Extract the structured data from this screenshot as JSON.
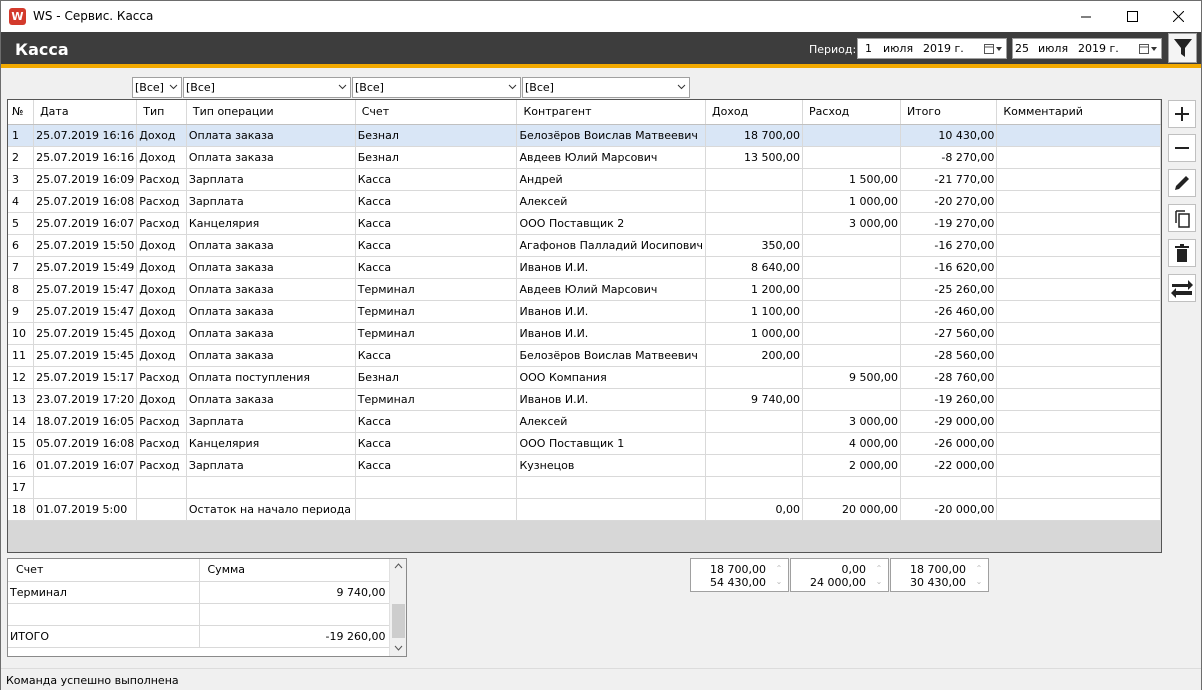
{
  "window": {
    "title": "WS - Сервис. Касса",
    "app_icon_letter": "W"
  },
  "header": {
    "title": "Касса",
    "period_label": "Период:",
    "date_from": {
      "day": "1",
      "month": "июля",
      "year": "2019 г."
    },
    "date_to": {
      "day": "25",
      "month": "июля",
      "year": "2019 г."
    }
  },
  "filters": [
    "[Все]",
    "[Все]",
    "[Все]",
    "[Все]"
  ],
  "grid": {
    "columns": [
      "№",
      "Дата",
      "Тип",
      "Тип операции",
      "Счет",
      "Контрагент",
      "Доход",
      "Расход",
      "Итого",
      "Комментарий"
    ],
    "rows": [
      [
        "1",
        "25.07.2019 16:16",
        "Доход",
        "Оплата заказа",
        "Безнал",
        "Белозёров Воислав Матвеевич",
        "18 700,00",
        "",
        "10 430,00",
        ""
      ],
      [
        "2",
        "25.07.2019 16:16",
        "Доход",
        "Оплата заказа",
        "Безнал",
        "Авдеев Юлий Марсович",
        "13 500,00",
        "",
        "-8 270,00",
        ""
      ],
      [
        "3",
        "25.07.2019 16:09",
        "Расход",
        "Зарплата",
        "Касса",
        "Андрей",
        "",
        "1 500,00",
        "-21 770,00",
        ""
      ],
      [
        "4",
        "25.07.2019 16:08",
        "Расход",
        "Зарплата",
        "Касса",
        "Алексей",
        "",
        "1 000,00",
        "-20 270,00",
        ""
      ],
      [
        "5",
        "25.07.2019 16:07",
        "Расход",
        "Канцелярия",
        "Касса",
        "ООО Поставщик 2",
        "",
        "3 000,00",
        "-19 270,00",
        ""
      ],
      [
        "6",
        "25.07.2019 15:50",
        "Доход",
        "Оплата заказа",
        "Касса",
        "Агафонов Палладий Иосипович",
        "350,00",
        "",
        "-16 270,00",
        ""
      ],
      [
        "7",
        "25.07.2019 15:49",
        "Доход",
        "Оплата заказа",
        "Касса",
        "Иванов И.И.",
        "8 640,00",
        "",
        "-16 620,00",
        ""
      ],
      [
        "8",
        "25.07.2019 15:47",
        "Доход",
        "Оплата заказа",
        "Терминал",
        "Авдеев Юлий Марсович",
        "1 200,00",
        "",
        "-25 260,00",
        ""
      ],
      [
        "9",
        "25.07.2019 15:47",
        "Доход",
        "Оплата заказа",
        "Терминал",
        "Иванов И.И.",
        "1 100,00",
        "",
        "-26 460,00",
        ""
      ],
      [
        "10",
        "25.07.2019 15:45",
        "Доход",
        "Оплата заказа",
        "Терминал",
        "Иванов И.И.",
        "1 000,00",
        "",
        "-27 560,00",
        ""
      ],
      [
        "11",
        "25.07.2019 15:45",
        "Доход",
        "Оплата заказа",
        "Касса",
        "Белозёров Воислав Матвеевич",
        "200,00",
        "",
        "-28 560,00",
        ""
      ],
      [
        "12",
        "25.07.2019 15:17",
        "Расход",
        "Оплата поступления",
        "Безнал",
        "ООО Компания",
        "",
        "9 500,00",
        "-28 760,00",
        ""
      ],
      [
        "13",
        "23.07.2019 17:20",
        "Доход",
        "Оплата заказа",
        "Терминал",
        "Иванов И.И.",
        "9 740,00",
        "",
        "-19 260,00",
        ""
      ],
      [
        "14",
        "18.07.2019 16:05",
        "Расход",
        "Зарплата",
        "Касса",
        "Алексей",
        "",
        "3 000,00",
        "-29 000,00",
        ""
      ],
      [
        "15",
        "05.07.2019 16:08",
        "Расход",
        "Канцелярия",
        "Касса",
        "ООО Поставщик 1",
        "",
        "4 000,00",
        "-26 000,00",
        ""
      ],
      [
        "16",
        "01.07.2019 16:07",
        "Расход",
        "Зарплата",
        "Касса",
        "Кузнецов",
        "",
        "2 000,00",
        "-22 000,00",
        ""
      ],
      [
        "17",
        "",
        "",
        "",
        "",
        "",
        "",
        "",
        "",
        ""
      ],
      [
        "18",
        "01.07.2019 5:00",
        "",
        "Остаток на начало периода",
        "",
        "",
        "0,00",
        "20 000,00",
        "-20 000,00",
        ""
      ]
    ],
    "selected_row": 0
  },
  "toolbar": {
    "add": "plus-icon",
    "remove": "minus-icon",
    "edit": "pencil-icon",
    "copy": "copy-icon",
    "delete": "trash-icon",
    "transfer": "transfer-icon"
  },
  "summary": {
    "columns": [
      "Счет",
      "Сумма"
    ],
    "rows": [
      [
        "Терминал",
        "9 740,00"
      ],
      [
        "",
        ""
      ],
      [
        "ИТОГО",
        "-19 260,00"
      ]
    ]
  },
  "totals": [
    {
      "top": "18 700,00",
      "bottom": "54 430,00"
    },
    {
      "top": "0,00",
      "bottom": "24 000,00"
    },
    {
      "top": "18 700,00",
      "bottom": "30 430,00"
    }
  ],
  "status": {
    "message": "Команда успешно выполнена"
  },
  "colors": {
    "header_bg": "#3d3d3d",
    "accent": "#f2a900",
    "selected_row": "#d9e6f6"
  }
}
